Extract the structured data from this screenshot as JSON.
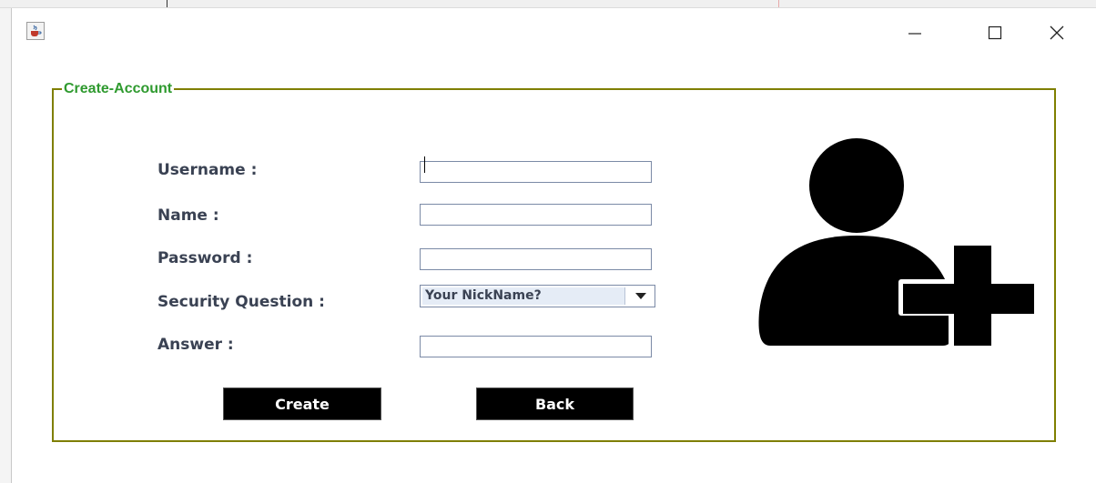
{
  "window": {
    "app_icon": "java-coffee-icon",
    "controls": {
      "minimize": "minimize-icon",
      "maximize": "maximize-icon",
      "close": "close-icon"
    }
  },
  "form": {
    "title": "Create-Account",
    "fields": {
      "username": {
        "label": "Username :",
        "value": ""
      },
      "name": {
        "label": "Name :",
        "value": ""
      },
      "password": {
        "label": "Password :",
        "value": ""
      },
      "security_question": {
        "label": "Security Question :",
        "selected": "Your NickName?"
      },
      "answer": {
        "label": "Answer :",
        "value": ""
      }
    },
    "buttons": {
      "create": "Create",
      "back": "Back"
    },
    "illustration": "add-user-icon"
  },
  "colors": {
    "border": "#7f7f00",
    "title": "#2f9a2f",
    "label": "#3a4253",
    "button_bg": "#000000"
  }
}
